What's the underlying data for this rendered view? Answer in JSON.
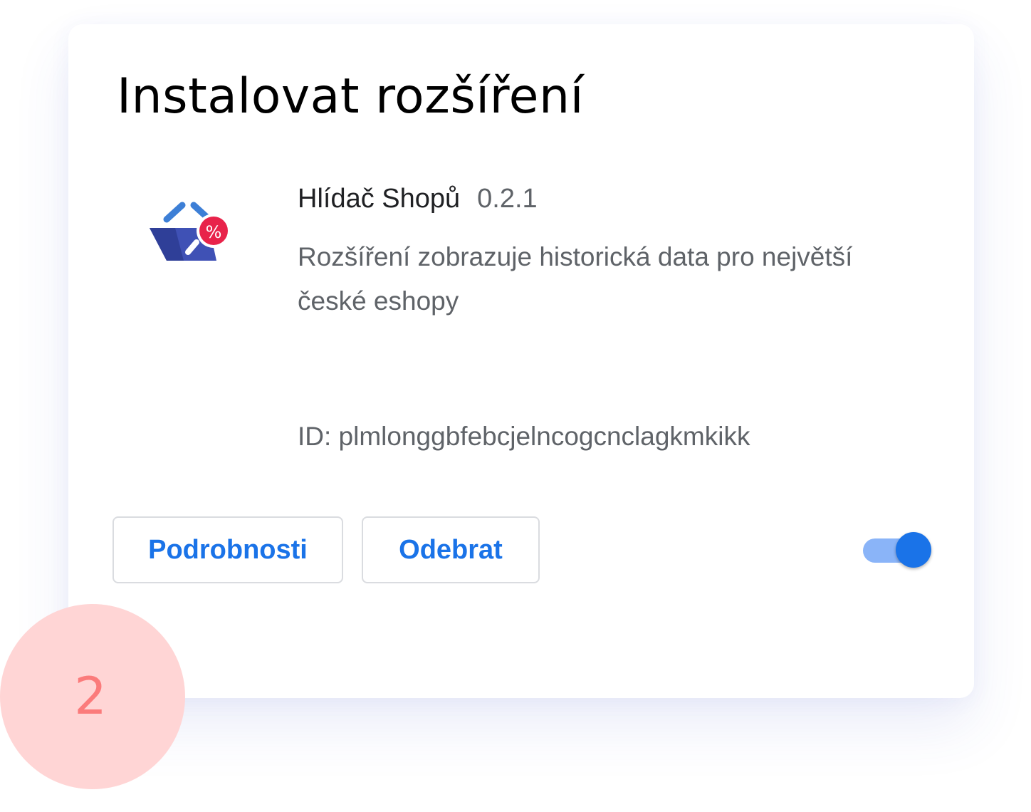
{
  "dialog": {
    "title": "Instalovat rozšíření"
  },
  "extension": {
    "name": "Hlídač Shopů",
    "version": "0.2.1",
    "description": "Rozšíření zobrazuje historická data pro největší české eshopy",
    "id_text": "ID: plmlonggbfebcjelncogcnclagkmkikk",
    "icon": "basket-percent-icon",
    "enabled": true
  },
  "actions": {
    "details_label": "Podrobnosti",
    "remove_label": "Odebrat"
  },
  "step": {
    "number": "2"
  },
  "colors": {
    "accent": "#1a73e8",
    "toggle_track": "#8ab4f8",
    "badge_bg": "#ffd5d5",
    "badge_text": "#fb7b7b",
    "icon_basket": "#3f51b5",
    "icon_badge": "#e8234a"
  }
}
